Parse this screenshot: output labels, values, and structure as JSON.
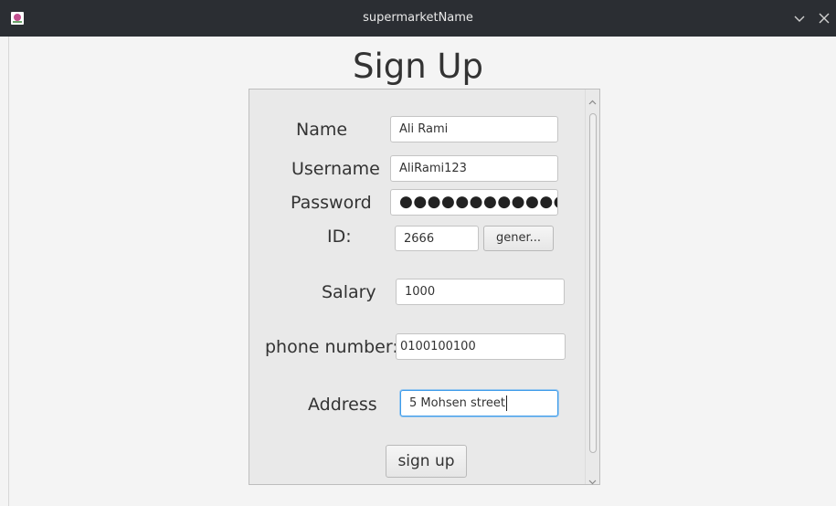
{
  "window": {
    "title": "supermarketName",
    "controls": {
      "minimize_icon": "chevron-down-icon",
      "close_icon": "close-icon"
    }
  },
  "form": {
    "heading": "Sign Up",
    "name": {
      "label": "Name",
      "value": "Ali Rami"
    },
    "username": {
      "label": "Username",
      "value": "AliRami123"
    },
    "password": {
      "label": "Password",
      "masked": "●●●●●●●●●●●●●"
    },
    "id": {
      "label": "ID:",
      "value": "2666",
      "generate_button": "gener..."
    },
    "salary": {
      "label": "Salary",
      "value": "1000"
    },
    "phone": {
      "label": "phone number:",
      "value": "0100100100"
    },
    "address": {
      "label": "Address",
      "value": "5 Mohsen street"
    },
    "submit": "sign up"
  },
  "colors": {
    "titlebar": "#2b2e33",
    "background": "#f4f4f4",
    "panel": "#e9e9e9",
    "focus": "#3d9be9"
  }
}
